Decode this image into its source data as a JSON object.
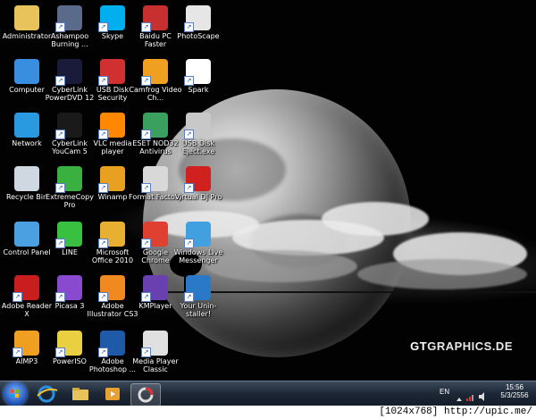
{
  "desktop": {
    "icons": [
      {
        "label": "Administrator",
        "icon": "folder-user-icon",
        "shortcut": false
      },
      {
        "label": "Ashampoo Burning ...",
        "icon": "ashampoo-icon",
        "shortcut": true
      },
      {
        "label": "Skype",
        "icon": "skype-icon",
        "shortcut": true
      },
      {
        "label": "Baidu PC Faster",
        "icon": "baidu-shield-icon",
        "shortcut": true
      },
      {
        "label": "PhotoScape",
        "icon": "photoscape-icon",
        "shortcut": true
      },
      {
        "label": "Computer",
        "icon": "computer-icon",
        "shortcut": false
      },
      {
        "label": "CyberLink PowerDVD 12",
        "icon": "powerdvd-icon",
        "shortcut": true
      },
      {
        "label": "USB Disk Security",
        "icon": "usb-security-icon",
        "shortcut": true
      },
      {
        "label": "Camfrog Video Ch...",
        "icon": "camfrog-icon",
        "shortcut": true
      },
      {
        "label": "Spark",
        "icon": "spark-paw-icon",
        "shortcut": true
      },
      {
        "label": "Network",
        "icon": "network-globe-icon",
        "shortcut": false
      },
      {
        "label": "CyberLink YouCam 5",
        "icon": "youcam-icon",
        "shortcut": true
      },
      {
        "label": "VLC media player",
        "icon": "vlc-cone-icon",
        "shortcut": true
      },
      {
        "label": "ESET NOD32 Antivirus",
        "icon": "eset-icon",
        "shortcut": true
      },
      {
        "label": "USB Disk Eject.exe",
        "icon": "usb-eject-icon",
        "shortcut": true
      },
      {
        "label": "Recycle Bin",
        "icon": "recycle-bin-icon",
        "shortcut": false
      },
      {
        "label": "ExtremeCopy Pro",
        "icon": "extremecopy-icon",
        "shortcut": true
      },
      {
        "label": "Winamp",
        "icon": "winamp-icon",
        "shortcut": true
      },
      {
        "label": "Format Factory",
        "icon": "format-factory-icon",
        "shortcut": true
      },
      {
        "label": "Virtual DJ Pro",
        "icon": "virtual-dj-icon",
        "shortcut": true
      },
      {
        "label": "Control Panel",
        "icon": "control-panel-icon",
        "shortcut": false
      },
      {
        "label": "LINE",
        "icon": "line-icon",
        "shortcut": true
      },
      {
        "label": "Microsoft Office 2010",
        "icon": "office-icon",
        "shortcut": true
      },
      {
        "label": "Google Chrome",
        "icon": "chrome-icon",
        "shortcut": true
      },
      {
        "label": "Windows Live Messenger",
        "icon": "messenger-icon",
        "shortcut": true
      },
      {
        "label": "Adobe Reader X",
        "icon": "adobe-reader-icon",
        "shortcut": true
      },
      {
        "label": "Picasa 3",
        "icon": "picasa-icon",
        "shortcut": true
      },
      {
        "label": "Adobe Illustrator CS3",
        "icon": "illustrator-icon",
        "shortcut": true
      },
      {
        "label": "KMPlayer",
        "icon": "kmplayer-icon",
        "shortcut": true
      },
      {
        "label": "Your Unin-staller!",
        "icon": "uninstaller-icon",
        "shortcut": true
      },
      {
        "label": "AIMP3",
        "icon": "aimp-icon",
        "shortcut": true
      },
      {
        "label": "PowerISO",
        "icon": "poweriso-disc-icon",
        "shortcut": true
      },
      {
        "label": "Adobe Photoshop ...",
        "icon": "photoshop-icon",
        "shortcut": true
      },
      {
        "label": "Media Player Classic",
        "icon": "mpc-clapper-icon",
        "shortcut": true
      }
    ],
    "watermark": {
      "part1": "GT",
      "part2": "GRAPHICS.DE"
    }
  },
  "taskbar": {
    "pinned": [
      {
        "icon": "internet-explorer-icon"
      },
      {
        "icon": "windows-explorer-icon"
      },
      {
        "icon": "media-player-icon"
      },
      {
        "icon": "photoscape-icon"
      }
    ],
    "tray": {
      "language": "EN",
      "time": "15:56",
      "date": "5/3/2556"
    }
  },
  "ribbon": {
    "text": "[1024x768] http://upic.me/"
  },
  "colors": {
    "taskbar": "#1c2634",
    "start_orb": "#1e4fb3",
    "ribbon": "#ffffff"
  }
}
